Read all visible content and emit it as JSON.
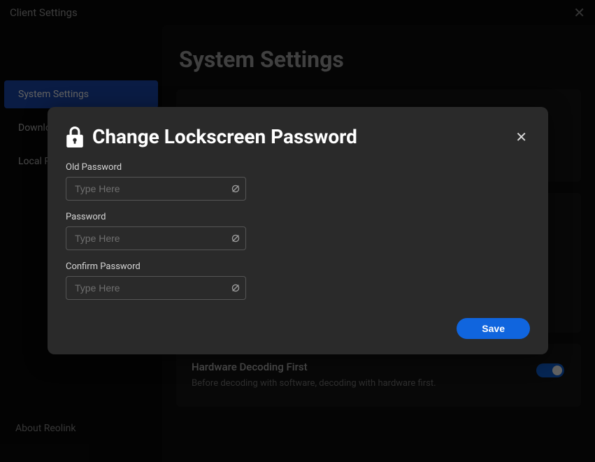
{
  "header": {
    "title": "Client Settings"
  },
  "sidebar": {
    "items": [
      {
        "label": "System Settings",
        "active": true
      },
      {
        "label": "Download",
        "active": false
      },
      {
        "label": "Local Recording",
        "active": false
      }
    ],
    "footer": "About Reolink"
  },
  "main": {
    "page_title": "System Settings",
    "hardware": {
      "title": "Hardware Decoding First",
      "desc": "Before decoding with software, decoding with hardware first."
    }
  },
  "modal": {
    "title": "Change Lockscreen Password",
    "fields": {
      "old": {
        "label": "Old Password",
        "placeholder": "Type Here"
      },
      "new": {
        "label": "Password",
        "placeholder": "Type Here"
      },
      "confirm": {
        "label": "Confirm Password",
        "placeholder": "Type Here"
      }
    },
    "save_label": "Save"
  }
}
